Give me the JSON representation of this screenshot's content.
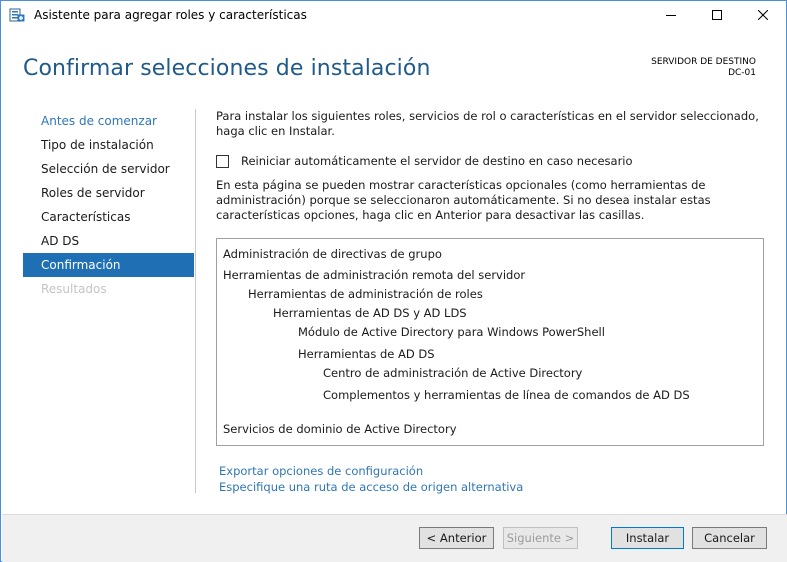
{
  "window": {
    "title": "Asistente para agregar roles y características"
  },
  "header": {
    "title": "Confirmar selecciones de instalación",
    "dest_label": "SERVIDOR DE DESTINO",
    "dest_server": "DC-01"
  },
  "nav": {
    "items": [
      {
        "label": "Antes de comenzar",
        "state": "link"
      },
      {
        "label": "Tipo de instalación",
        "state": "normal"
      },
      {
        "label": "Selección de servidor",
        "state": "normal"
      },
      {
        "label": "Roles de servidor",
        "state": "normal"
      },
      {
        "label": "Características",
        "state": "normal"
      },
      {
        "label": "AD DS",
        "state": "normal"
      },
      {
        "label": "Confirmación",
        "state": "active"
      },
      {
        "label": "Resultados",
        "state": "disabled"
      }
    ]
  },
  "content": {
    "intro": "Para instalar los siguientes roles, servicios de rol o características en el servidor seleccionado, haga clic en Instalar.",
    "restart_checkbox": {
      "label": "Reiniciar automáticamente el servidor de destino en caso necesario",
      "checked": false
    },
    "note": "En esta página se pueden mostrar características opcionales (como herramientas de administración) porque se seleccionaron automáticamente. Si no desea instalar estas características opciones, haga clic en Anterior para desactivar las casillas.",
    "selections": [
      {
        "label": "Administración de directivas de grupo",
        "level": 0
      },
      {
        "label": "Herramientas de administración remota del servidor",
        "level": 0
      },
      {
        "label": "Herramientas de administración de roles",
        "level": 1
      },
      {
        "label": "Herramientas de AD DS y AD LDS",
        "level": 2
      },
      {
        "label": "Módulo de Active Directory para Windows PowerShell",
        "level": 3
      },
      {
        "label": "Herramientas de AD DS",
        "level": 3
      },
      {
        "label": "Centro de administración de Active Directory",
        "level": 4
      },
      {
        "label": "Complementos y herramientas de línea de comandos de AD DS",
        "level": 4
      },
      {
        "label": "Servicios de dominio de Active Directory",
        "level": 0
      }
    ],
    "export_link": "Exportar opciones de configuración",
    "alt_source_link": "Especifique una ruta de acceso de origen alternativa"
  },
  "footer": {
    "prev_label": "< Anterior",
    "next_label": "Siguiente >",
    "install_label": "Instalar",
    "cancel_label": "Cancelar"
  },
  "colors": {
    "accent": "#1f6fb5",
    "title": "#1f5a8a",
    "link": "#2f77b5"
  }
}
